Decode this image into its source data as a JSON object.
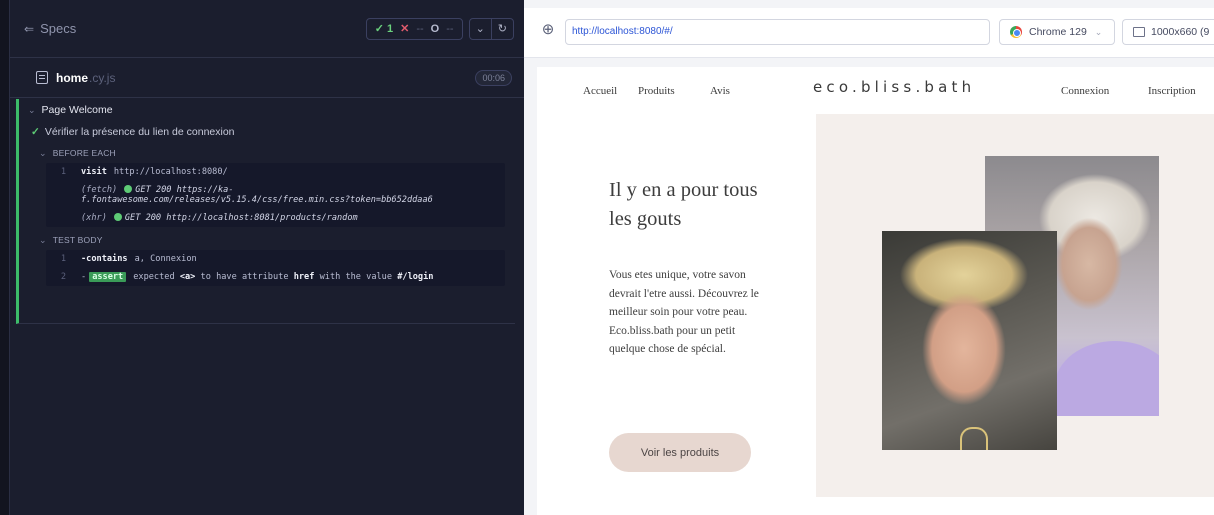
{
  "cypress": {
    "specs_label": "Specs",
    "stats": {
      "passed": "✓ 1",
      "failed": "✕",
      "failed_count": "--",
      "pending": "O",
      "pending_count": "--"
    },
    "controls": {
      "dropdown": "⌄",
      "reload": "↻"
    },
    "file": {
      "name": "home",
      "ext": ".cy.js",
      "duration": "00:06"
    },
    "suite": {
      "title": "Page Welcome",
      "test_title": "Vérifier la présence du lien de connexion",
      "before_each_label": "BEFORE EACH",
      "test_body_label": "TEST BODY",
      "before_each": [
        {
          "num": "1",
          "command": "visit",
          "arg": "http://localhost:8080/"
        },
        {
          "tag": "(fetch)",
          "text": "GET 200 https://ka-f.fontawesome.com/releases/v5.15.4/css/free.min.css?token=bb652ddaa6"
        },
        {
          "tag": "(xhr)",
          "text": "GET 200 http://localhost:8081/products/random"
        }
      ],
      "test_body": [
        {
          "num": "1",
          "command": "-contains",
          "arg": "a, Connexion"
        },
        {
          "num": "2",
          "assert": "assert",
          "text_a": "expected",
          "em_a": "<a>",
          "text_b": "to have attribute",
          "em_b": "href",
          "text_c": "with the value",
          "em_c": "#/login"
        }
      ]
    },
    "colors": {
      "panel_bg": "#1b1e2e",
      "pass": "#5ecb76",
      "fail": "#e25c6d"
    }
  },
  "aut": {
    "url": "http://localhost:8080/#/",
    "browser": "Chrome 129",
    "viewport": "1000x660 (9",
    "site": {
      "nav": {
        "home": "Accueil",
        "products": "Produits",
        "reviews": "Avis",
        "login": "Connexion",
        "register": "Inscription"
      },
      "brand": "eco.bliss.bath",
      "hero_title": "Il y en a pour tous les gouts",
      "hero_text": "Vous etes unique, votre savon devrait l'etre aussi. Découvrez le meilleur soin pour votre peau. Eco.bliss.bath pour un petit quelque chose de spécial.",
      "cta": "Voir les produits"
    }
  }
}
